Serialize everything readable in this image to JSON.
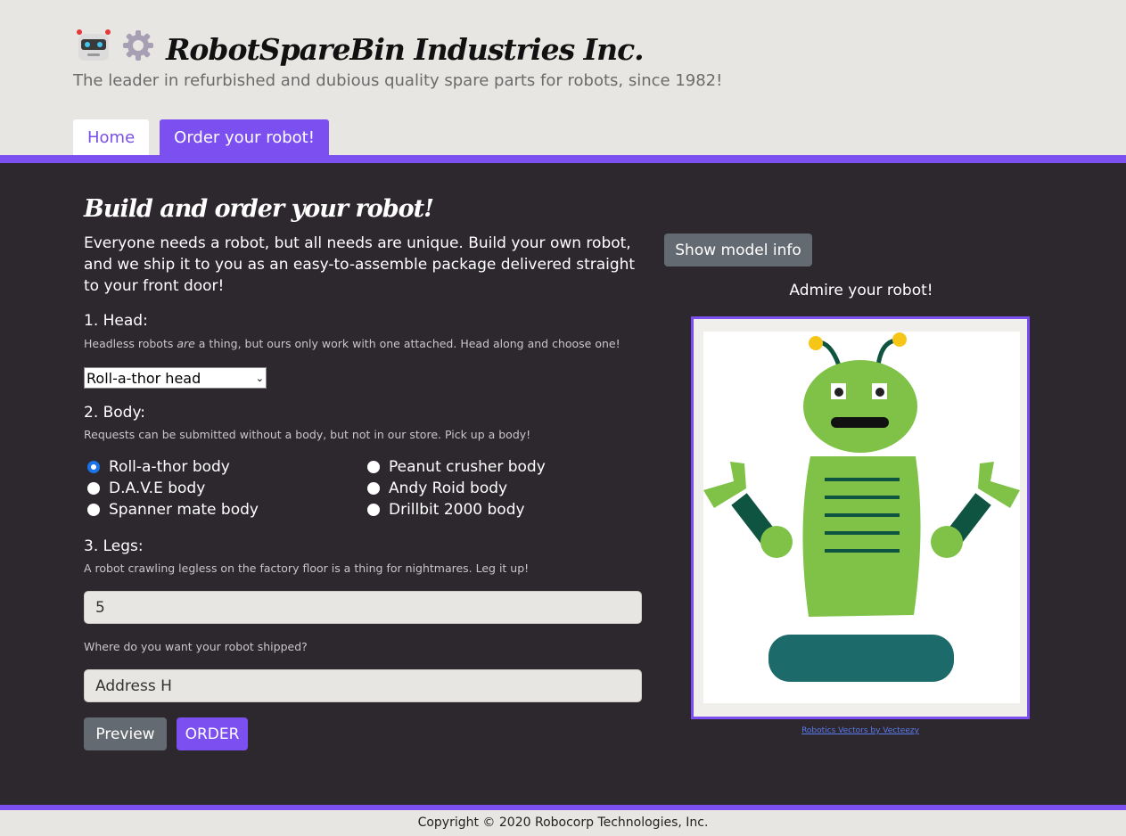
{
  "header": {
    "logo_icons": [
      "robot-face-icon",
      "gear-icon"
    ],
    "title": "RobotSpareBin Industries Inc.",
    "tagline": "The leader in refurbished and dubious quality spare parts for robots, since 1982!"
  },
  "nav": {
    "home_label": "Home",
    "order_label": "Order your robot!",
    "active": "Order your robot!"
  },
  "form": {
    "heading": "Build and order your robot!",
    "intro": "Everyone needs a robot, but all needs are unique. Build your own robot, and we ship it to you as an easy-to-assemble package delivered straight to your front door!",
    "head": {
      "title": "1. Head:",
      "help_before": "Headless robots ",
      "help_em": "are",
      "help_after": " a thing, but ours only work with one attached. Head along and choose one!",
      "selected": "Roll-a-thor head"
    },
    "body": {
      "title": "2. Body:",
      "help": "Requests can be submitted without a body, but not in our store. Pick up a body!",
      "options": [
        {
          "label": "Roll-a-thor body",
          "checked": true
        },
        {
          "label": "Peanut crusher body",
          "checked": false
        },
        {
          "label": "D.A.V.E body",
          "checked": false
        },
        {
          "label": "Andy Roid body",
          "checked": false
        },
        {
          "label": "Spanner mate body",
          "checked": false
        },
        {
          "label": "Drillbit 2000 body",
          "checked": false
        }
      ]
    },
    "legs": {
      "title": "3. Legs:",
      "help": "A robot crawling legless on the factory floor is a thing for nightmares. Leg it up!",
      "value": "5"
    },
    "address": {
      "help": "Where do you want your robot shipped?",
      "value": "Address H"
    },
    "preview_label": "Preview",
    "order_label": "ORDER"
  },
  "preview_panel": {
    "model_button": "Show model info",
    "caption": "Admire your robot!",
    "credit": "Robotics Vectors by Vecteezy"
  },
  "footer": {
    "copyright": "Copyright © 2020 Robocorp Technologies, Inc."
  },
  "colors": {
    "accent": "#7c4ff0",
    "dark_bg": "#2d272e",
    "light_bg": "#e8e6e2",
    "secondary_button": "#646a71",
    "robot_green": "#7fc247",
    "robot_dark_green": "#0f5440",
    "robot_teal": "#1c6a6a",
    "antenna_yellow": "#f5c518"
  }
}
